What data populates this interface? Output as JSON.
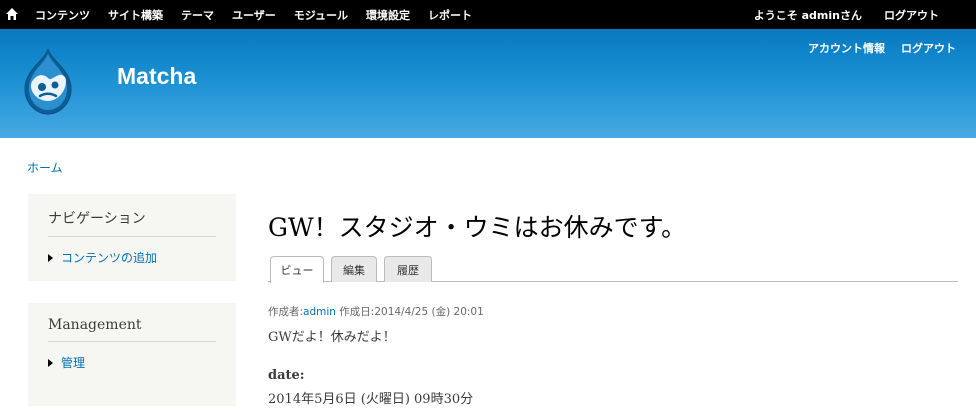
{
  "toolbar": {
    "menu": [
      "コンテンツ",
      "サイト構築",
      "テーマ",
      "ユーザー",
      "モジュール",
      "環境設定",
      "レポート"
    ],
    "welcome": "ようこそ adminさん",
    "logout": "ログアウト"
  },
  "header": {
    "site_name": "Matcha",
    "secondary_menu": [
      "アカウント情報",
      "ログアウト"
    ]
  },
  "breadcrumb": "ホーム",
  "sidebar": {
    "navigation": {
      "title": "ナビゲーション",
      "items": [
        "コンテンツの追加"
      ]
    },
    "management": {
      "title": "Management",
      "items": [
        "管理"
      ]
    }
  },
  "node": {
    "title": "GW！スタジオ・ウミはお休みです。",
    "tabs": [
      "ビュー",
      "編集",
      "履歴"
    ],
    "meta": {
      "author_label": "作成者:",
      "author": "admin",
      "date": " 作成日:2014/4/25 (金) 20:01"
    },
    "body": "GWだよ！休みだよ！",
    "date_field": {
      "label": "date:",
      "value": "2014年5月6日 (火曜日) 09時30分"
    }
  },
  "colors": {
    "toolbar_bg": "#000000",
    "header_top": "#0779bf",
    "header_bottom": "#48a9e4",
    "link": "#0071b3",
    "sidebar_bg": "#f6f6f2"
  }
}
